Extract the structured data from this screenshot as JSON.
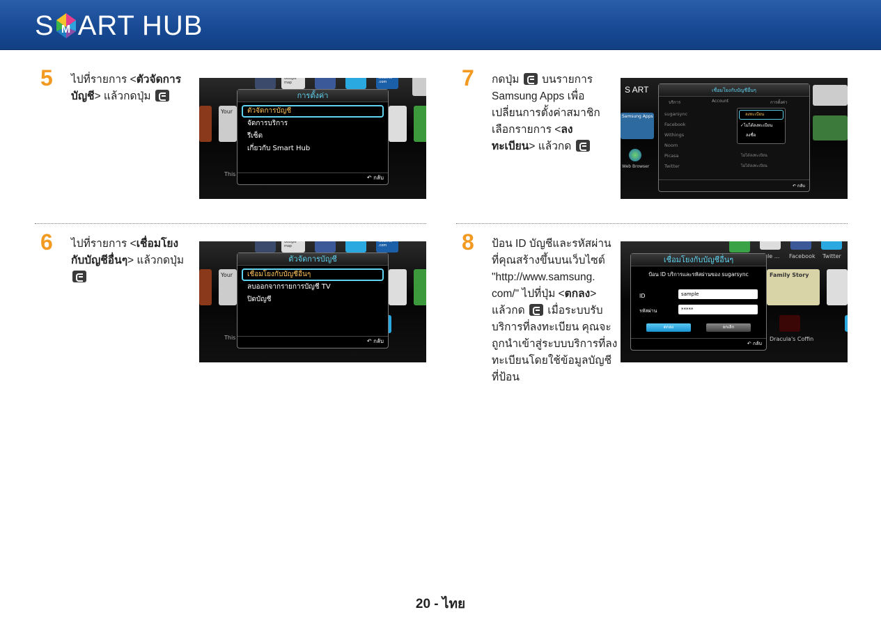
{
  "header": {
    "logo_s": "S",
    "logo_art": "ART",
    "logo_hub": "HUB"
  },
  "colors": {
    "header": "#174993",
    "step_number": "#f39a23",
    "highlight": "#5fd3f0",
    "selected_text": "#ffc35a"
  },
  "steps": [
    {
      "number": "5",
      "line1_pre": "ไปที่รายการ <",
      "line1_bold": "ตัวจัดการ",
      "line2_bold": "บัญชี",
      "line2_post": "> แล้วกดปุ่ม"
    },
    {
      "number": "6",
      "line1_pre": "ไปที่รายการ <",
      "line1_bold": "เชื่อมโยง",
      "line2_bold": "กับบัญชีอื่นๆ",
      "line2_post": "> แล้วกดปุ่ม"
    },
    {
      "number": "7",
      "line1_pre": "กดปุ่ม",
      "line1_post": "บนรายการ",
      "line2": "Samsung Apps เพื่อ",
      "line3": "เปลี่ยนการตั้งค่าสมาชิก",
      "line4_pre": "เลือกรายการ <",
      "line4_bold": "ลง",
      "line5_bold": "ทะเบียน",
      "line5_post": "> แล้วกด"
    },
    {
      "number": "8",
      "line1": "ป้อน ID บัญชีและรหัสผ่าน",
      "line2": "ที่คุณสร้างขึ้นบนเว็บไซต์",
      "line3": "\"http://www.samsung.",
      "line4_pre": "com/\" ไปที่ปุ่ม <",
      "line4_bold": "ตกลง",
      "line4_post": ">",
      "line5_pre": "แล้วกด",
      "line5_post": "เมื่อระบบรับ",
      "line6": "บริการที่ลงทะเบียน คุณจะ",
      "line7": "ถูกนำเข้าสู่ระบบบริการที่ลง",
      "line8": "ทะเบียนโดยใช้ข้อมูลบัญชี",
      "line9": "ที่ป้อน"
    }
  ],
  "shot5": {
    "title": "การตั้งค่า",
    "items": [
      "ตัวจัดการบัญชี",
      "จัดการบริการ",
      "รีเซ็ต",
      "เกี่ยวกับ Smart Hub"
    ],
    "back": "กลับ",
    "tile_labels": [
      "Your",
      "Weather .com",
      "Google map",
      "This"
    ]
  },
  "shot6": {
    "title": "ตัวจัดการบัญชี",
    "items": [
      "เชื่อมโยงกับบัญชีอื่นๆ",
      "ลบออกจากรายการบัญชี TV",
      "ปิดบัญชี"
    ],
    "back": "กลับ",
    "tile_labels": [
      "Your",
      "Weather .com",
      "Google map",
      "This"
    ]
  },
  "shot7": {
    "title": "เชื่อมโยงกับบัญชีอื่นๆ",
    "cols": [
      "บริการ",
      "Account",
      "การตั้งค่า"
    ],
    "services": [
      "sugarsync",
      "Facebook",
      "Withings",
      "Noom",
      "Picasa",
      "Twitter"
    ],
    "status": "ไม่ได้ลงทะเบียน",
    "menu": [
      "ลงทะเบียน",
      "ไม่ได้ลงทะเบียน",
      "ลงชื่อ"
    ],
    "logo": "S ART",
    "apps": "Samsung Apps",
    "browser": "Web Browser",
    "back": "กลับ"
  },
  "shot8": {
    "title": "เชื่อมโยงกับบัญชีอื่นๆ",
    "prompt": "ป้อน ID บริการและรหัสผ่านของ sugarsync",
    "id_label": "ID",
    "id_value": "sample",
    "pw_label": "รหัสผ่าน",
    "pw_value": "*****",
    "ok": "ตกลง",
    "cancel": "ยกเลิก",
    "back": "กลับ",
    "tiles": [
      "Facebook",
      "Twitter",
      "Family Story",
      "Dracula's Coffin",
      "gle ..."
    ]
  },
  "footer": "20 - ไทย"
}
